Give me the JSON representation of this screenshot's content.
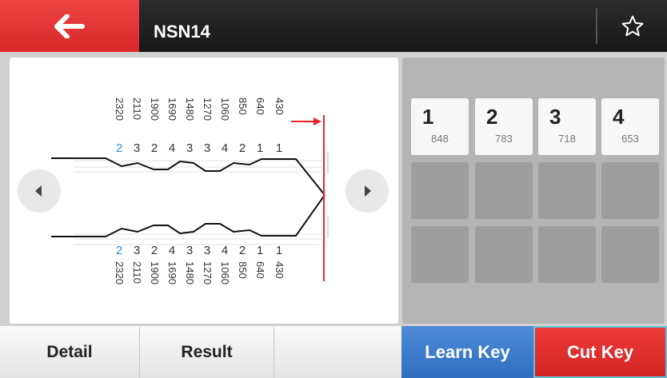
{
  "header": {
    "title": "NSN14",
    "back_icon": "arrow-left-icon",
    "favorite_icon": "star-outline-icon"
  },
  "diagram": {
    "depth_values": [
      "2320",
      "2110",
      "1900",
      "1690",
      "1480",
      "1270",
      "1060",
      "850",
      "640",
      "430"
    ],
    "top_cuts": [
      "2",
      "3",
      "2",
      "4",
      "3",
      "3",
      "4",
      "2",
      "1",
      "1"
    ],
    "bottom_cuts": [
      "2",
      "3",
      "2",
      "4",
      "3",
      "3",
      "4",
      "2",
      "1",
      "1"
    ],
    "highlight_color": "#2d8fd5",
    "marker_color": "#e8262a",
    "prev_icon": "triangle-left-icon",
    "next_icon": "triangle-right-icon"
  },
  "cut_grid": {
    "cells": [
      {
        "number": "1",
        "value": "848"
      },
      {
        "number": "2",
        "value": "783"
      },
      {
        "number": "3",
        "value": "718"
      },
      {
        "number": "4",
        "value": "653"
      }
    ]
  },
  "bottom": {
    "detail_label": "Detail",
    "result_label": "Result",
    "learn_label": "Learn Key",
    "cut_label": "Cut Key"
  },
  "colors": {
    "accent_red": "#e03030",
    "learn_blue": "#3a78c8",
    "focus_outline": "#5fc8d8"
  }
}
